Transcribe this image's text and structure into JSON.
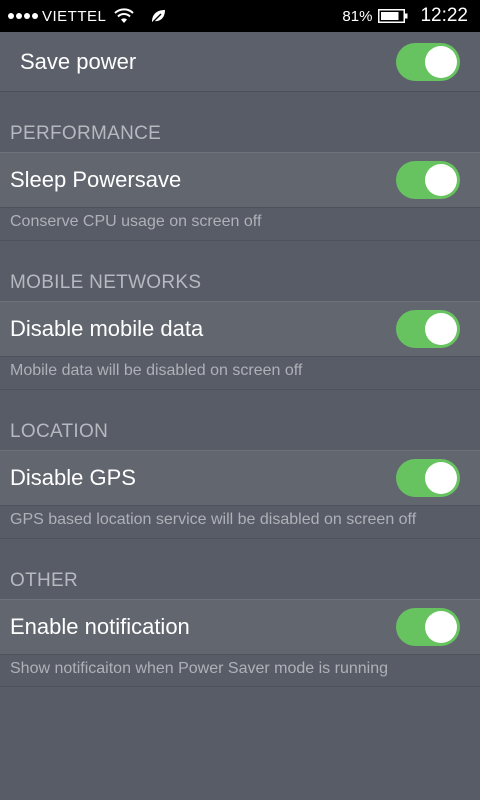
{
  "status_bar": {
    "carrier": "VIETTEL",
    "battery": "81%",
    "time": "12:22"
  },
  "save_power": {
    "label": "Save power",
    "enabled": true
  },
  "sections": [
    {
      "header": "PERFORMANCE",
      "setting": {
        "label": "Sleep Powersave",
        "description": "Conserve CPU usage on screen off",
        "enabled": true
      }
    },
    {
      "header": "MOBILE NETWORKS",
      "setting": {
        "label": "Disable mobile data",
        "description": "Mobile data will be disabled on screen off",
        "enabled": true
      }
    },
    {
      "header": "LOCATION",
      "setting": {
        "label": "Disable GPS",
        "description": "GPS based location service will be disabled on screen off",
        "enabled": true
      }
    },
    {
      "header": "OTHER",
      "setting": {
        "label": "Enable notification",
        "description": "Show notificaiton when Power Saver mode is running",
        "enabled": true
      }
    }
  ],
  "colors": {
    "toggle_on": "#67c35f",
    "background": "#585c66"
  }
}
